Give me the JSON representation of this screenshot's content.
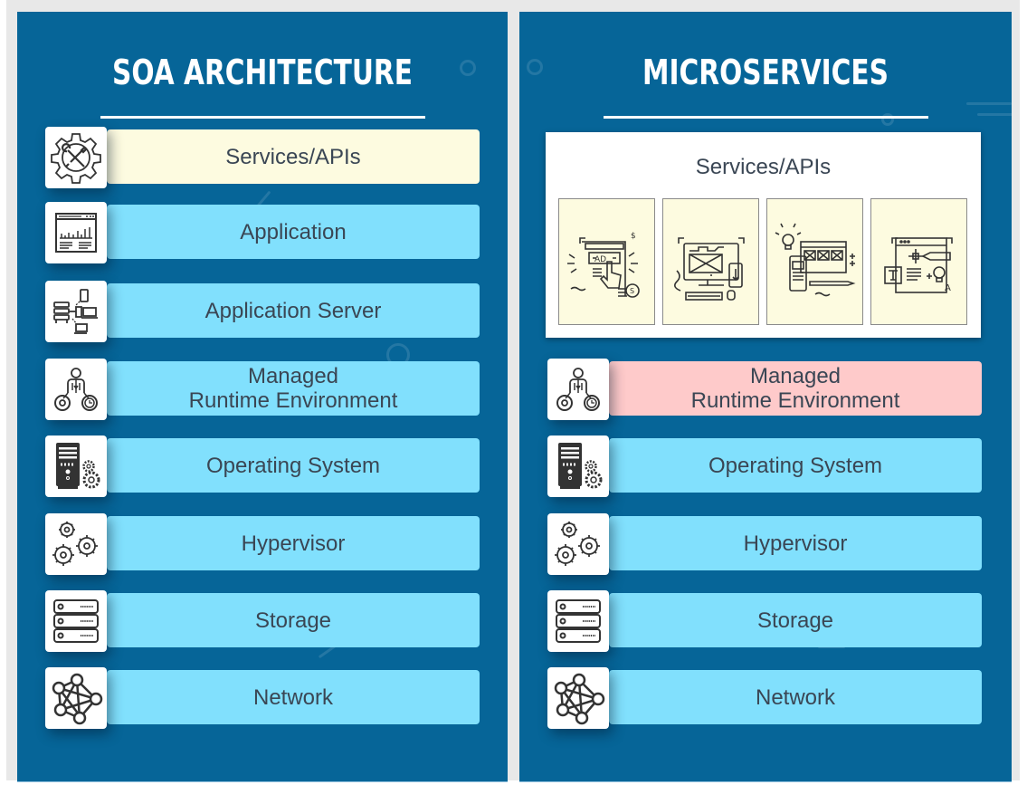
{
  "colors": {
    "panel_background": "#066598",
    "layer_default": "#81e0fd",
    "layer_highlight_services": "#fdfbe0",
    "layer_highlight_runtime": "#fecaca",
    "text": "#3a4654",
    "title": "#ffffff"
  },
  "left_panel": {
    "title": "SOA ARCHITECTURE",
    "layers": [
      {
        "label": "Services/APIs",
        "icon": "gear-tools-icon",
        "style": "yellow"
      },
      {
        "label": "Application",
        "icon": "dashboard-window-icon",
        "style": "default"
      },
      {
        "label": "Application Server",
        "icon": "server-devices-icon",
        "style": "default"
      },
      {
        "label_line1": "Managed",
        "label_line2": "Runtime Environment",
        "icon": "runtime-person-gears-icon",
        "style": "default"
      },
      {
        "label": "Operating System",
        "icon": "computer-tower-gears-icon",
        "style": "default"
      },
      {
        "label": "Hypervisor",
        "icon": "cogs-icon",
        "style": "default"
      },
      {
        "label": "Storage",
        "icon": "storage-rack-icon",
        "style": "default"
      },
      {
        "label": "Network",
        "icon": "network-nodes-icon",
        "style": "default"
      }
    ]
  },
  "right_panel": {
    "title": "MICROSERVICES",
    "services": {
      "label": "Services/APIs",
      "cards": [
        {
          "icon": "advertising-click-icon"
        },
        {
          "icon": "desktop-mobile-download-icon"
        },
        {
          "icon": "web-design-idea-icon"
        },
        {
          "icon": "typography-pen-tool-icon"
        }
      ]
    },
    "layers": [
      {
        "label_line1": "Managed",
        "label_line2": "Runtime Environment",
        "icon": "runtime-person-gears-icon",
        "style": "pink"
      },
      {
        "label": "Operating System",
        "icon": "computer-tower-gears-icon",
        "style": "default"
      },
      {
        "label": "Hypervisor",
        "icon": "cogs-icon",
        "style": "default"
      },
      {
        "label": "Storage",
        "icon": "storage-rack-icon",
        "style": "default"
      },
      {
        "label": "Network",
        "icon": "network-nodes-icon",
        "style": "default"
      }
    ]
  }
}
